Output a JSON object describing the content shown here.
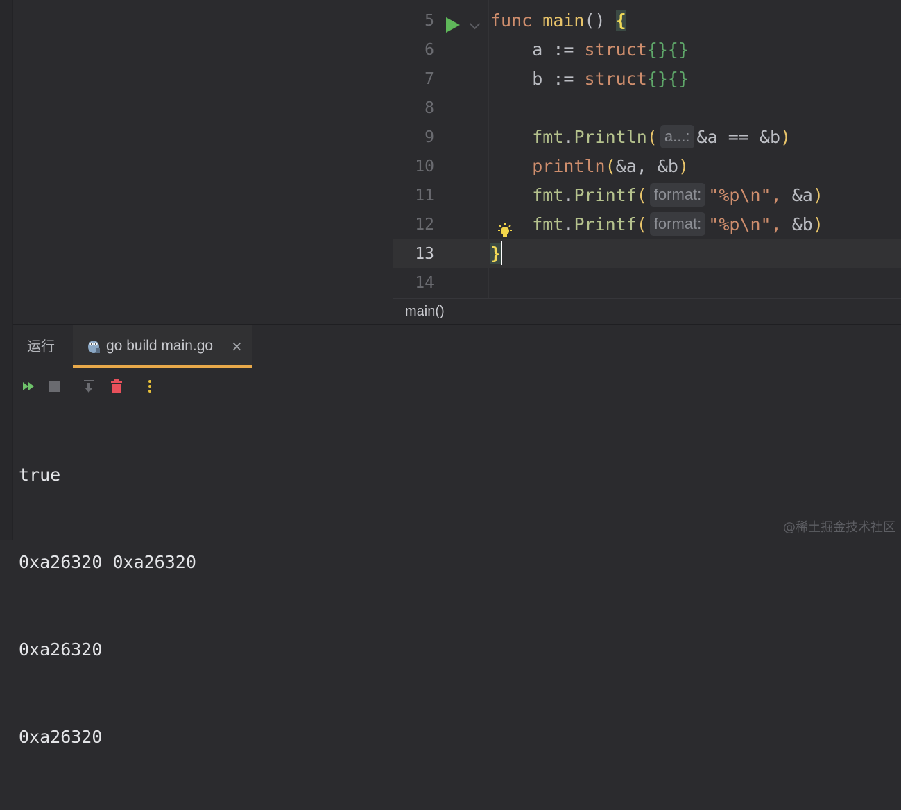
{
  "editor": {
    "lines": [
      {
        "num": "5"
      },
      {
        "num": "6"
      },
      {
        "num": "7"
      },
      {
        "num": "8"
      },
      {
        "num": "9"
      },
      {
        "num": "10"
      },
      {
        "num": "11"
      },
      {
        "num": "12"
      },
      {
        "num": "13"
      },
      {
        "num": "14"
      }
    ],
    "tokens": {
      "func": "func",
      "main": "main",
      "parens": "()",
      "open_brace": "{",
      "a": "a",
      "b": "b",
      "assign": ":=",
      "struct": "struct",
      "struct_braces": "{}{}",
      "fmt": "fmt",
      "dot": ".",
      "println_fn": "Println",
      "printf_fn": "Printf",
      "builtin_println": "println",
      "open_paren": "(",
      "close_paren": ")",
      "hint_a": "a...:",
      "hint_format": "format:",
      "amp_a": "&a",
      "amp_b": "&b",
      "eqeq": "==",
      "comma": ",",
      "fmt_str": "\"%p\\n\"",
      "close_brace": "}"
    },
    "breadcrumb": "main()"
  },
  "panel": {
    "tab_run_label": "运行",
    "tab_label": "go build main.go",
    "tab_close": "×",
    "icons": [
      "rerun-icon",
      "stop-icon",
      "scroll-to-end-icon",
      "clear-all-icon",
      "more-options-icon"
    ]
  },
  "console": {
    "lines": [
      "true",
      "0xa26320 0xa26320",
      "0xa26320",
      "0xa26320"
    ]
  },
  "watermark": "@稀土掘金技术社区",
  "colors": {
    "background": "#2b2b2e",
    "keyword": "#cf8e6d",
    "function": "#e8c46a",
    "string": "#6aab73",
    "run_icon": "#5fb85a",
    "tab_underline": "#e8a94a",
    "clear_icon": "#e8505b"
  }
}
